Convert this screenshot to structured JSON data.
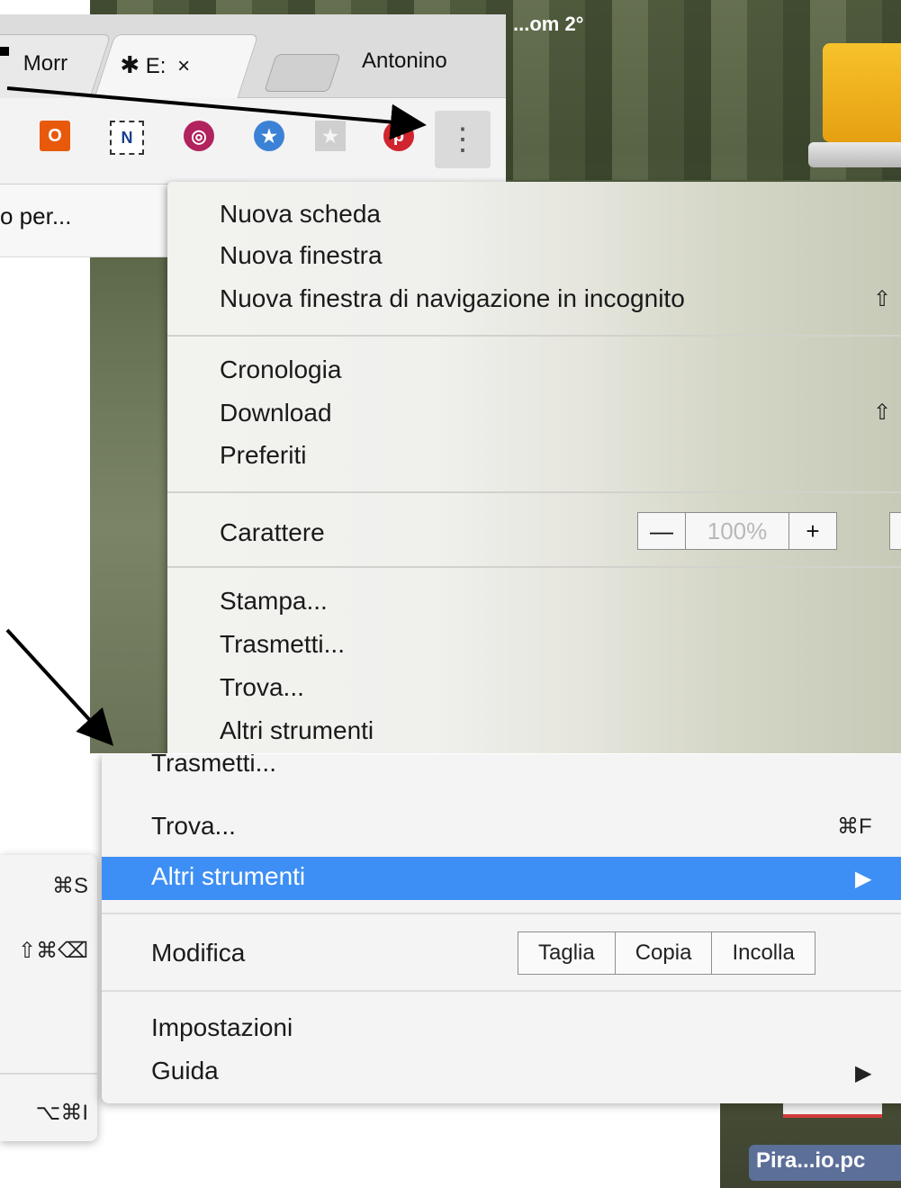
{
  "top": {
    "desktop_label": "...om 2°",
    "tabs": [
      {
        "label": "Morr",
        "icon": "tab-edge"
      },
      {
        "label": "E:",
        "close": "×",
        "icon": "puzzle-icon"
      }
    ],
    "profile_name": "Antonino",
    "bookmark_text": "o per...",
    "toolbar_extensions": [
      "office-icon",
      "onenote-icon",
      "circle-app-icon",
      "star-circle-icon",
      "gray-star-icon",
      "pinterest-icon"
    ],
    "menu_button_glyph": "⋮",
    "menu": {
      "group1": [
        {
          "label": "Nuova scheda"
        },
        {
          "label": "Nuova finestra"
        },
        {
          "label": "Nuova finestra di navigazione in incognito",
          "shortcut": "⇧"
        }
      ],
      "group2": [
        {
          "label": "Cronologia"
        },
        {
          "label": "Download",
          "shortcut": "⇧"
        },
        {
          "label": "Preferiti"
        }
      ],
      "zoom": {
        "label": "Carattere",
        "minus": "—",
        "value": "100%",
        "plus": "+"
      },
      "group3": [
        {
          "label": "Stampa..."
        },
        {
          "label": "Trasmetti..."
        },
        {
          "label": "Trova..."
        },
        {
          "label": "Altri strumenti"
        }
      ]
    }
  },
  "bottom": {
    "submenu_shortcuts": [
      "⌘S",
      "⇧⌘⌫",
      "⌥⌘I"
    ],
    "menu": {
      "items_top": [
        {
          "label": "Trasmetti..."
        },
        {
          "label": "Trova...",
          "shortcut": "⌘F"
        },
        {
          "label": "Altri strumenti",
          "arrow": "▶"
        }
      ],
      "edit": {
        "label": "Modifica",
        "buttons": [
          "Taglia",
          "Copia",
          "Incolla"
        ]
      },
      "items_bottom": [
        {
          "label": "Impostazioni"
        },
        {
          "label": "Guida",
          "arrow": "▶"
        }
      ]
    },
    "desktop_file_label": "Pira...io.pc"
  },
  "colors": {
    "highlight": "#3d8ff5",
    "pinterest": "#d0242e",
    "office": "#e8590c"
  }
}
